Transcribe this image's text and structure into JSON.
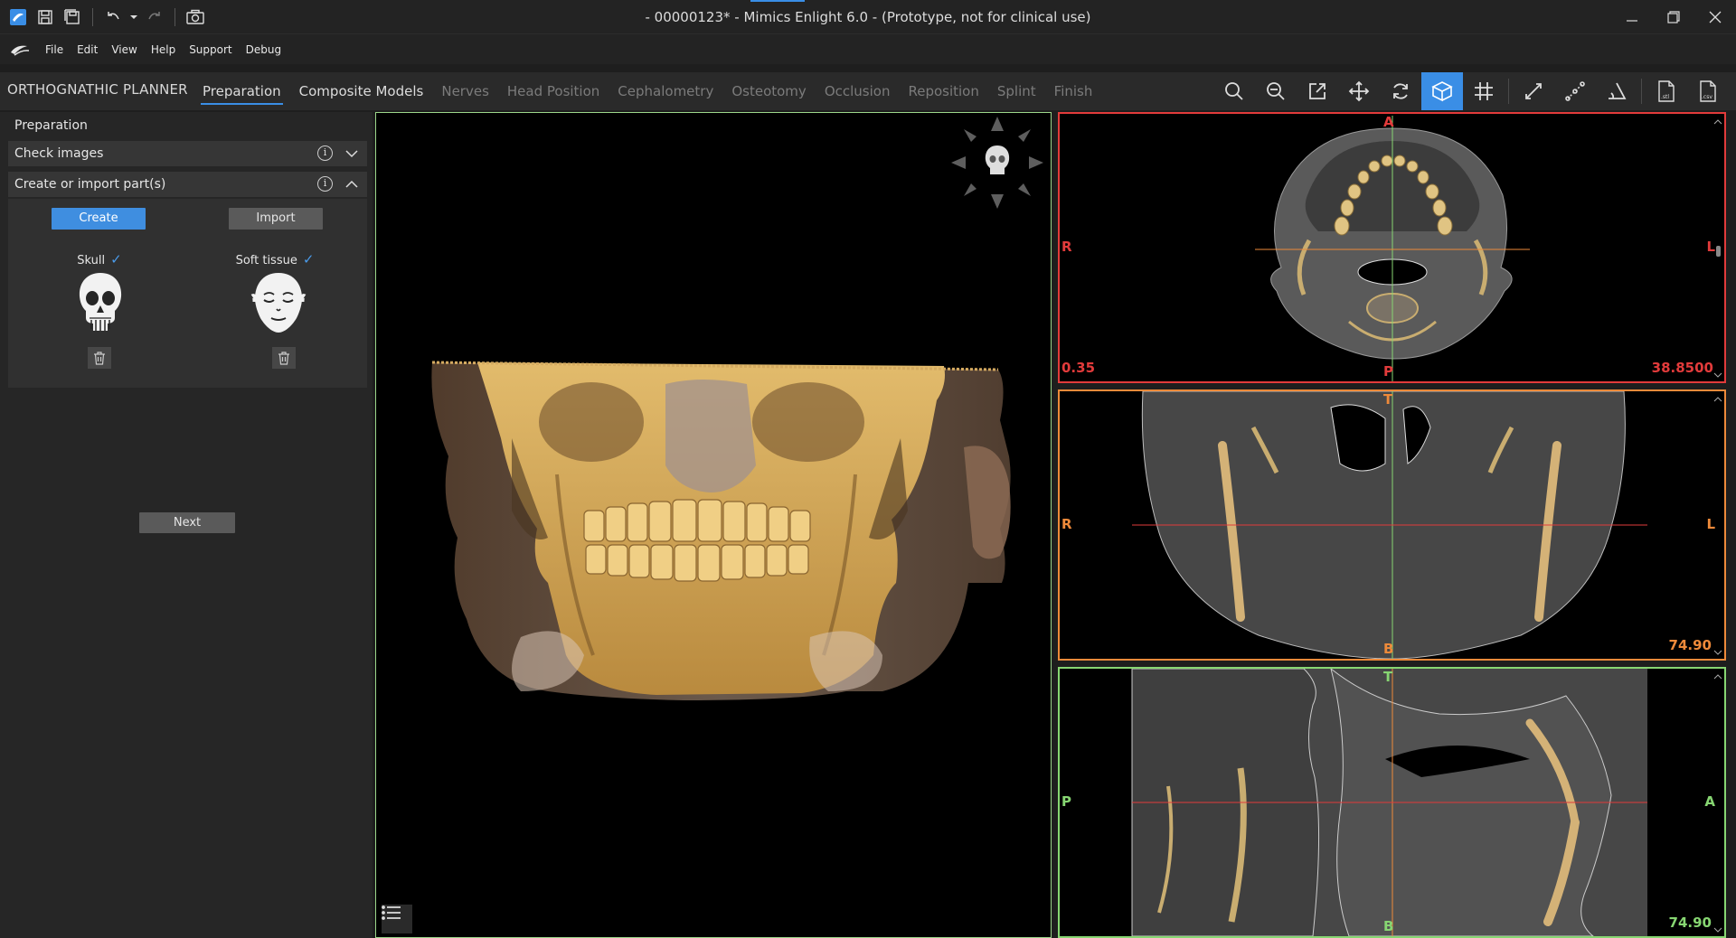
{
  "window": {
    "title": "- 00000123* - Mimics Enlight 6.0  - (Prototype, not for clinical use)"
  },
  "menu": [
    "File",
    "Edit",
    "View",
    "Help",
    "Support",
    "Debug"
  ],
  "workflow": {
    "title": "ORTHOGNATHIC PLANNER",
    "tabs": [
      {
        "label": "Preparation",
        "state": "active"
      },
      {
        "label": "Composite Models",
        "state": "enabled"
      },
      {
        "label": "Nerves",
        "state": "disabled"
      },
      {
        "label": "Head Position",
        "state": "disabled"
      },
      {
        "label": "Cephalometry",
        "state": "disabled"
      },
      {
        "label": "Osteotomy",
        "state": "disabled"
      },
      {
        "label": "Occlusion",
        "state": "disabled"
      },
      {
        "label": "Reposition",
        "state": "disabled"
      },
      {
        "label": "Splint",
        "state": "disabled"
      },
      {
        "label": "Finish",
        "state": "disabled"
      }
    ]
  },
  "panel": {
    "title": "Preparation",
    "check_images": "Check images",
    "create_import": "Create or import part(s)",
    "create_label": "Create",
    "import_label": "Import",
    "skull_label": "Skull",
    "soft_tissue_label": "Soft tissue",
    "next_label": "Next"
  },
  "views": {
    "axial": {
      "top": "A",
      "bottom": "P",
      "left": "R",
      "right": "L",
      "left_value": "0.35",
      "right_value": "38.8500",
      "color": "#e23b3b"
    },
    "coronal": {
      "top": "T",
      "bottom": "B",
      "left": "R",
      "right": "L",
      "right_value": "74.90",
      "color": "#ee8a3a"
    },
    "sagittal": {
      "top": "T",
      "bottom": "B",
      "left": "P",
      "right": "A",
      "right_value": "74.90",
      "color": "#87d672"
    }
  },
  "colors": {
    "accent": "#3a8ee6",
    "bone": "#d8b070",
    "view3d_border": "#9cd68a"
  }
}
